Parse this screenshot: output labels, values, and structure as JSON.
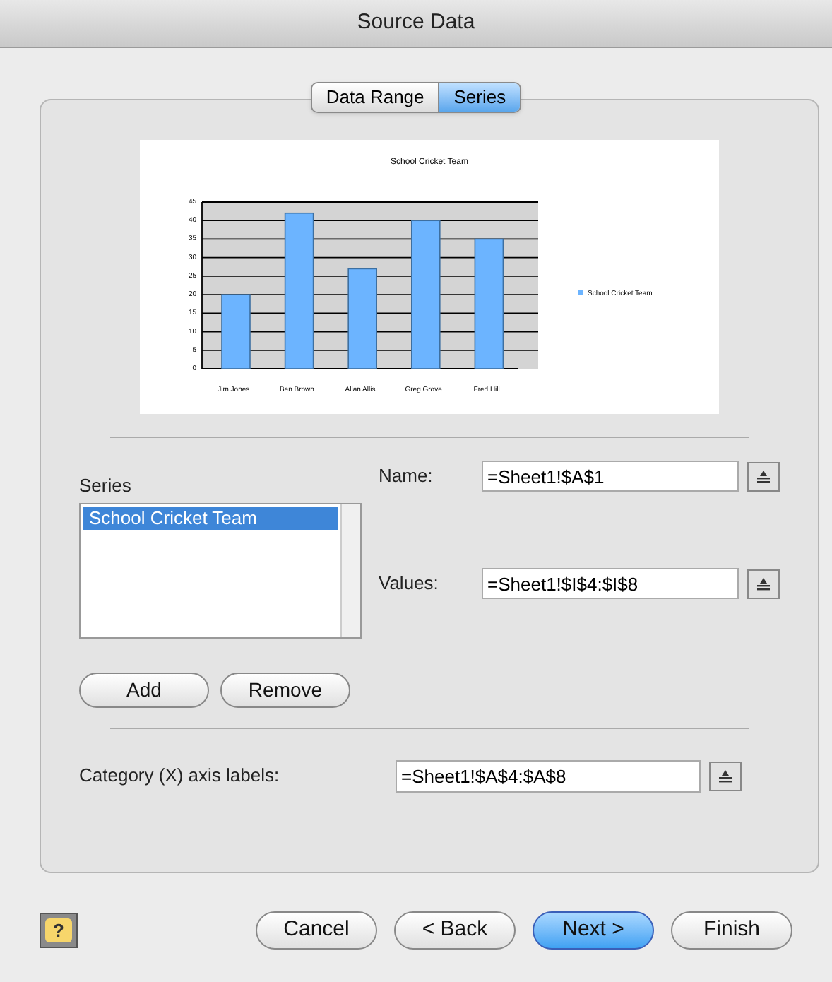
{
  "window": {
    "title": "Source Data"
  },
  "tabs": [
    {
      "label": "Data Range",
      "selected": false
    },
    {
      "label": "Series",
      "selected": true
    }
  ],
  "preview": {
    "chart_data": {
      "type": "bar",
      "title": "School Cricket Team",
      "categories": [
        "Jim Jones",
        "Ben Brown",
        "Allan Allis",
        "Greg Grove",
        "Fred Hill"
      ],
      "series": [
        {
          "name": "School Cricket Team",
          "color": "#6cb4ff",
          "values": [
            20,
            42,
            27,
            40,
            35
          ]
        }
      ],
      "ylim": [
        0,
        45
      ],
      "grid": true,
      "yticks": [
        0,
        5,
        10,
        15,
        20,
        25,
        30,
        35,
        40,
        45
      ]
    }
  },
  "series_list": {
    "label": "Series",
    "items": [
      {
        "label": "School Cricket Team",
        "selected": true
      }
    ]
  },
  "fields": [
    {
      "label": "Name:",
      "value": "=Sheet1!$A$1"
    },
    {
      "label": "Values:",
      "value": "=Sheet1!$I$4:$I$8"
    }
  ],
  "series_buttons": [
    "Add",
    "Remove"
  ],
  "category": {
    "label": "Category (X) axis labels:",
    "value": "=Sheet1!$A$4:$A$8"
  },
  "help": "?",
  "buttons": [
    {
      "label": "Cancel",
      "default": false
    },
    {
      "label": "< Back",
      "default": false
    },
    {
      "label": "Next >",
      "default": true
    },
    {
      "label": "Finish",
      "default": false
    }
  ]
}
